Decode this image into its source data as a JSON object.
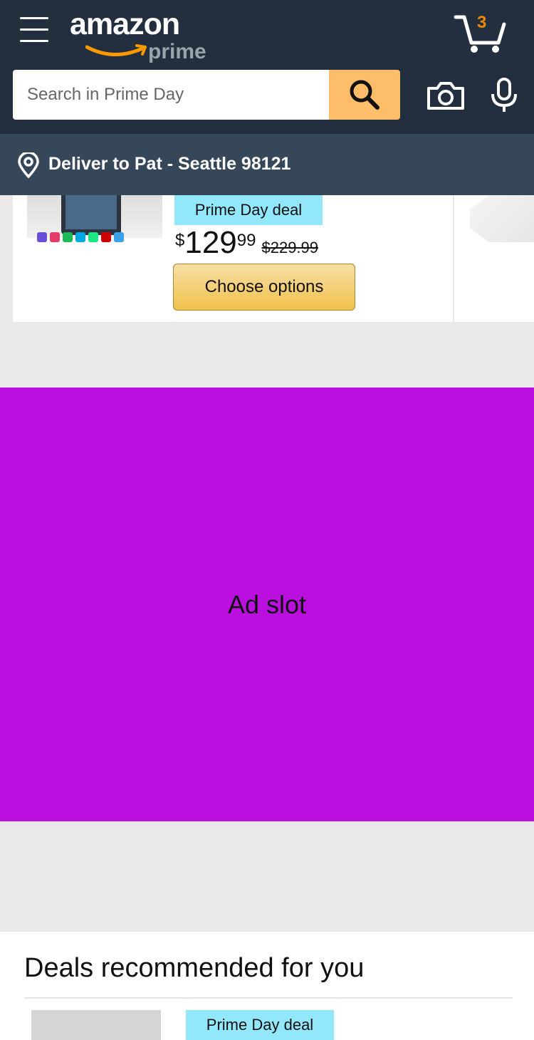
{
  "header": {
    "logo_text": "amazon",
    "logo_sub": "prime",
    "cart_count": "3",
    "search_placeholder": "Search in Prime Day",
    "deliver_text": "Deliver to Pat - Seattle 98121"
  },
  "product": {
    "badge": "Prime Day deal",
    "price_symbol": "$",
    "price_whole": "129",
    "price_fraction": "99",
    "price_old": "$229.99",
    "button_label": "Choose options"
  },
  "ad": {
    "label": "Ad slot"
  },
  "deals": {
    "title": "Deals recommended for you",
    "badge": "Prime Day deal"
  },
  "colors": {
    "header_bg": "#232f3e",
    "deliver_bg": "#37475a",
    "search_button": "#febd69",
    "badge_bg": "#93e7fb",
    "ad_bg": "#bb0fdf",
    "cart_count": "#f08804"
  },
  "icons": [
    "menu-icon",
    "cart-icon",
    "search-icon",
    "camera-icon",
    "microphone-icon",
    "location-pin-icon"
  ]
}
